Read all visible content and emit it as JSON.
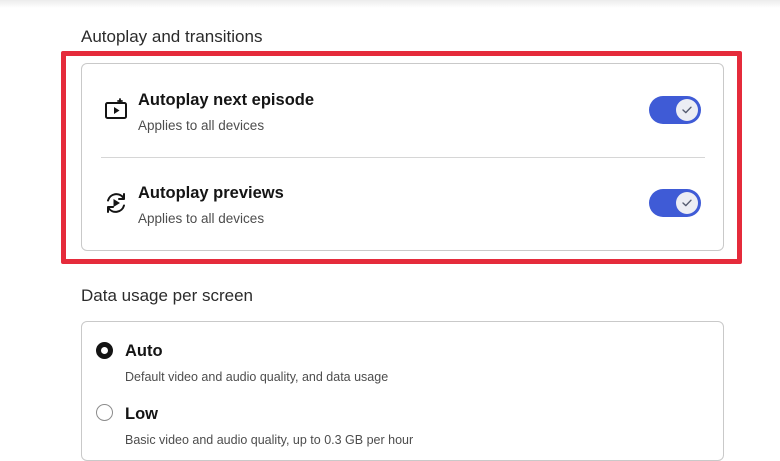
{
  "autoplay": {
    "heading": "Autoplay and transitions",
    "items": [
      {
        "icon": "autoplay-next-episode-icon",
        "title": "Autoplay next episode",
        "subtitle": "Applies to all devices",
        "enabled": true
      },
      {
        "icon": "autoplay-previews-icon",
        "title": "Autoplay previews",
        "subtitle": "Applies to all devices",
        "enabled": true
      }
    ]
  },
  "data_usage": {
    "heading": "Data usage per screen",
    "options": [
      {
        "label": "Auto",
        "description": "Default video and audio quality, and data usage",
        "selected": true
      },
      {
        "label": "Low",
        "description": "Basic video and audio quality, up to 0.3 GB per hour",
        "selected": false
      }
    ]
  },
  "colors": {
    "toggle_on": "#3f5bd6",
    "highlight_border": "#e52b3b",
    "card_border": "#c9c9c9"
  }
}
